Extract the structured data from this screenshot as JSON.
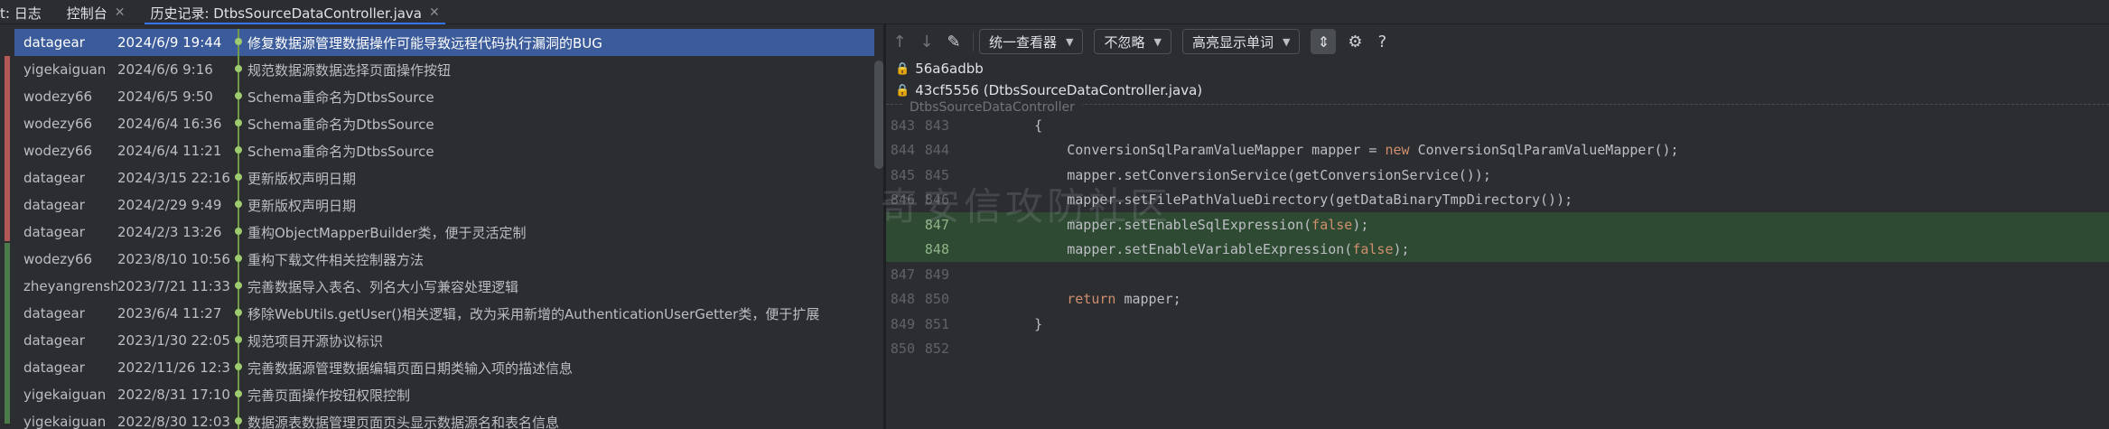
{
  "tabs": [
    {
      "label": "t: 日志",
      "active": false,
      "closable": false
    },
    {
      "label": "控制台",
      "active": false,
      "closable": true
    },
    {
      "label": "历史记录: DtbsSourceDataController.java",
      "active": true,
      "closable": true
    }
  ],
  "log": {
    "rows": [
      {
        "author": "datagear",
        "date": "2024/6/9 19:44",
        "message": "修复数据源管理数据操作可能导致远程代码执行漏洞的BUG",
        "selected": true
      },
      {
        "author": "yigekaiguan",
        "date": "2024/6/6 9:16",
        "message": "规范数据源数据选择页面操作按钮",
        "selected": false
      },
      {
        "author": "wodezy66",
        "date": "2024/6/5 9:50",
        "message": "Schema重命名为DtbsSource",
        "selected": false
      },
      {
        "author": "wodezy66",
        "date": "2024/6/4 16:36",
        "message": "Schema重命名为DtbsSource",
        "selected": false
      },
      {
        "author": "wodezy66",
        "date": "2024/6/4 11:21",
        "message": "Schema重命名为DtbsSource",
        "selected": false
      },
      {
        "author": "datagear",
        "date": "2024/3/15 22:16",
        "message": "更新版权声明日期",
        "selected": false
      },
      {
        "author": "datagear",
        "date": "2024/2/29 9:49",
        "message": "更新版权声明日期",
        "selected": false
      },
      {
        "author": "datagear",
        "date": "2024/2/3 13:26",
        "message": "重构ObjectMapperBuilder类，便于灵活定制",
        "selected": false
      },
      {
        "author": "wodezy66",
        "date": "2023/8/10 10:56",
        "message": "重构下载文件相关控制器方法",
        "selected": false
      },
      {
        "author": "zheyangrensh",
        "date": "2023/7/21 11:33",
        "message": "完善数据导入表名、列名大小写兼容处理逻辑",
        "selected": false
      },
      {
        "author": "datagear",
        "date": "2023/6/4 11:27",
        "message": "移除WebUtils.getUser()相关逻辑，改为采用新增的AuthenticationUserGetter类，便于扩展",
        "selected": false
      },
      {
        "author": "datagear",
        "date": "2023/1/30 22:05",
        "message": "规范项目开源协议标识",
        "selected": false
      },
      {
        "author": "datagear",
        "date": "2022/11/26 12:3",
        "message": "完善数据源管理数据编辑页面日期类输入项的描述信息",
        "selected": false
      },
      {
        "author": "yigekaiguan",
        "date": "2022/8/31 17:10",
        "message": "完善页面操作按钮权限控制",
        "selected": false
      },
      {
        "author": "yigekaiguan",
        "date": "2022/8/30 12:03",
        "message": "数据源表数据管理页面页头显示数据源名和表名信息",
        "selected": false
      }
    ]
  },
  "toolbar": {
    "viewer_dropdown": "统一查看器",
    "ignore_dropdown": "不忽略",
    "highlight_dropdown": "高亮显示单词",
    "help_label": "?"
  },
  "commits": {
    "old_hash": "56a6adbb",
    "new_hash_label": "43cf5556 (DtbsSourceDataController.java)"
  },
  "editor": {
    "breadcrumb": "DtbsSourceDataController",
    "lines": [
      {
        "old": "843",
        "new": "843",
        "added": false,
        "code": "    {"
      },
      {
        "old": "844",
        "new": "844",
        "added": false,
        "code": "        ConversionSqlParamValueMapper mapper = new ConversionSqlParamValueMapper();"
      },
      {
        "old": "845",
        "new": "845",
        "added": false,
        "code": "        mapper.setConversionService(getConversionService());"
      },
      {
        "old": "846",
        "new": "846",
        "added": false,
        "code": "        mapper.setFilePathValueDirectory(getDataBinaryTmpDirectory());"
      },
      {
        "old": "",
        "new": "847",
        "added": true,
        "code": "        mapper.setEnableSqlExpression(false);"
      },
      {
        "old": "",
        "new": "848",
        "added": true,
        "code": "        mapper.setEnableVariableExpression(false);"
      },
      {
        "old": "847",
        "new": "849",
        "added": false,
        "code": ""
      },
      {
        "old": "848",
        "new": "850",
        "added": false,
        "code": "        return mapper;"
      },
      {
        "old": "849",
        "new": "851",
        "added": false,
        "code": "    }"
      },
      {
        "old": "850",
        "new": "852",
        "added": false,
        "code": ""
      }
    ]
  },
  "watermark": "奇安信攻防社区",
  "colors": {
    "accent": "#3574f0",
    "selected_row": "#3b5b9a",
    "added_line": "#2f4a33",
    "keyword": "#cf8e6d"
  }
}
